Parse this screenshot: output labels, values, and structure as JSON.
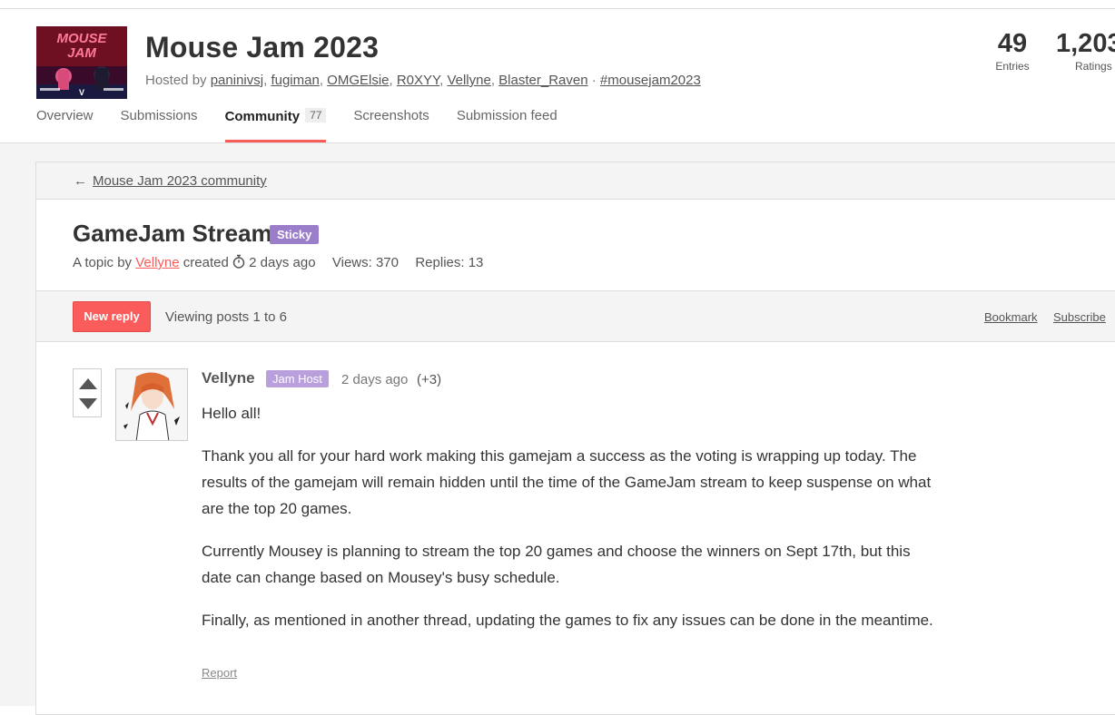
{
  "jam": {
    "title": "Mouse Jam 2023",
    "hosted_by_label": "Hosted by",
    "hosts": [
      "paninivsj",
      "fugiman",
      "OMGElsie",
      "R0XYY",
      "Vellyne",
      "Blaster_Raven"
    ],
    "separator": " · ",
    "hashtag": "#mousejam2023",
    "thumbnail": {
      "logo_line1": "MOUSE",
      "logo_line2": "JAM"
    }
  },
  "stats": {
    "entries": {
      "value": "49",
      "label": "Entries"
    },
    "ratings": {
      "value": "1,203",
      "label": "Ratings"
    }
  },
  "tabs": [
    {
      "label": "Overview",
      "active": false
    },
    {
      "label": "Submissions",
      "active": false
    },
    {
      "label": "Community",
      "active": true,
      "count": "77"
    },
    {
      "label": "Screenshots",
      "active": false
    },
    {
      "label": "Submission feed",
      "active": false
    }
  ],
  "breadcrumb": {
    "arrow": "←",
    "label": "Mouse Jam 2023 community"
  },
  "topic": {
    "title": "GameJam Stream",
    "badge": "Sticky",
    "prefix": "A topic by",
    "author": "Vellyne",
    "created_label": "created",
    "created_ago": "2 days ago",
    "views": "Views: 370",
    "replies": "Replies: 13"
  },
  "actions": {
    "new_reply": "New reply",
    "viewing": "Viewing posts 1 to 6",
    "bookmark": "Bookmark",
    "subscribe": "Subscribe"
  },
  "post": {
    "author": "Vellyne",
    "badge": "Jam Host",
    "time": "2 days ago",
    "votes": "(+3)",
    "paragraphs": [
      "Hello all!",
      "Thank you all for your hard work making this gamejam a success as the voting is wrapping up today. The results of the gamejam will remain hidden until the time of the GameJam stream to keep suspense on what are the top 20 games.",
      "Currently Mousey is planning to stream the top 20 games and choose the winners on Sept 17th, but this date can change based on Mousey's busy schedule.",
      "Finally, as mentioned in another thread, updating the games to fix any issues can be done in the meantime."
    ],
    "report": "Report"
  },
  "colors": {
    "accent": "#fa5c5c",
    "sticky_badge": "#9b7ec9",
    "host_badge": "#b9a0dc",
    "page_bg": "#f4f4f4"
  },
  "icons": {
    "timer": "stopwatch-icon",
    "upvote": "triangle-up-icon",
    "downvote": "triangle-down-icon"
  }
}
